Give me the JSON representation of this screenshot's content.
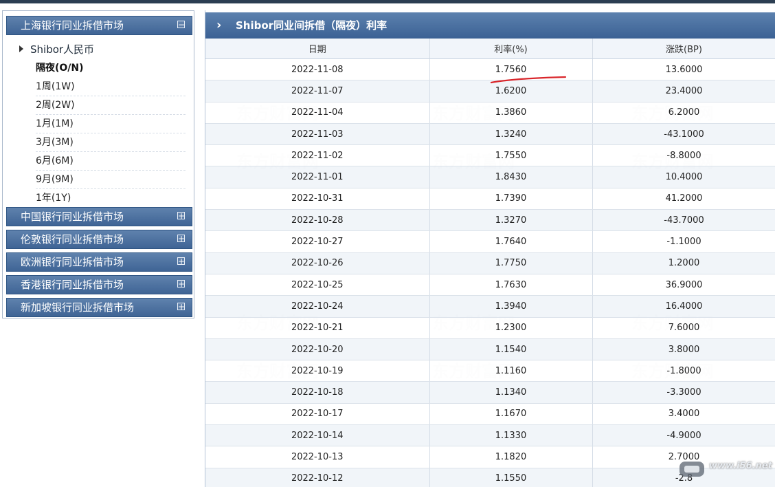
{
  "sidebar": {
    "categories": [
      {
        "label": "上海银行同业拆借市场",
        "toggle": "−"
      },
      {
        "label": "中国银行同业拆借市场",
        "toggle": "+"
      },
      {
        "label": "伦敦银行同业拆借市场",
        "toggle": "+"
      },
      {
        "label": "欧洲银行同业拆借市场",
        "toggle": "+"
      },
      {
        "label": "香港银行同业拆借市场",
        "toggle": "+"
      },
      {
        "label": "新加坡银行同业拆借市场",
        "toggle": "+"
      }
    ],
    "sub_header": "Shibor人民币",
    "terms": [
      "隔夜(O/N)",
      "1周(1W)",
      "2周(2W)",
      "1月(1M)",
      "3月(3M)",
      "6月(6M)",
      "9月(9M)",
      "1年(1Y)"
    ],
    "active_term": "隔夜(O/N)"
  },
  "panel": {
    "title": "Shibor同业间拆借（隔夜）利率",
    "columns": [
      "日期",
      "利率(%)",
      "涨跌(BP)"
    ],
    "rows": [
      [
        "2022-11-08",
        "1.7560",
        "13.6000"
      ],
      [
        "2022-11-07",
        "1.6200",
        "23.4000"
      ],
      [
        "2022-11-04",
        "1.3860",
        "6.2000"
      ],
      [
        "2022-11-03",
        "1.3240",
        "-43.1000"
      ],
      [
        "2022-11-02",
        "1.7550",
        "-8.8000"
      ],
      [
        "2022-11-01",
        "1.8430",
        "10.4000"
      ],
      [
        "2022-10-31",
        "1.7390",
        "41.2000"
      ],
      [
        "2022-10-28",
        "1.3270",
        "-43.7000"
      ],
      [
        "2022-10-27",
        "1.7640",
        "-1.1000"
      ],
      [
        "2022-10-26",
        "1.7750",
        "1.2000"
      ],
      [
        "2022-10-25",
        "1.7630",
        "36.9000"
      ],
      [
        "2022-10-24",
        "1.3940",
        "16.4000"
      ],
      [
        "2022-10-21",
        "1.2300",
        "7.6000"
      ],
      [
        "2022-10-20",
        "1.1540",
        "3.8000"
      ],
      [
        "2022-10-19",
        "1.1160",
        "-1.8000"
      ],
      [
        "2022-10-18",
        "1.1340",
        "-3.3000"
      ],
      [
        "2022-10-17",
        "1.1670",
        "3.4000"
      ],
      [
        "2022-10-14",
        "1.1330",
        "-4.9000"
      ],
      [
        "2022-10-13",
        "1.1820",
        "2.7000"
      ],
      [
        "2022-10-12",
        "1.1550",
        "-2.8"
      ]
    ]
  },
  "watermark": {
    "text": "东方财富网"
  },
  "corner_badge": {
    "text": "www.i56.net"
  },
  "colors": {
    "header_blue": "#3f6495",
    "annotation_red": "#d9262b"
  }
}
